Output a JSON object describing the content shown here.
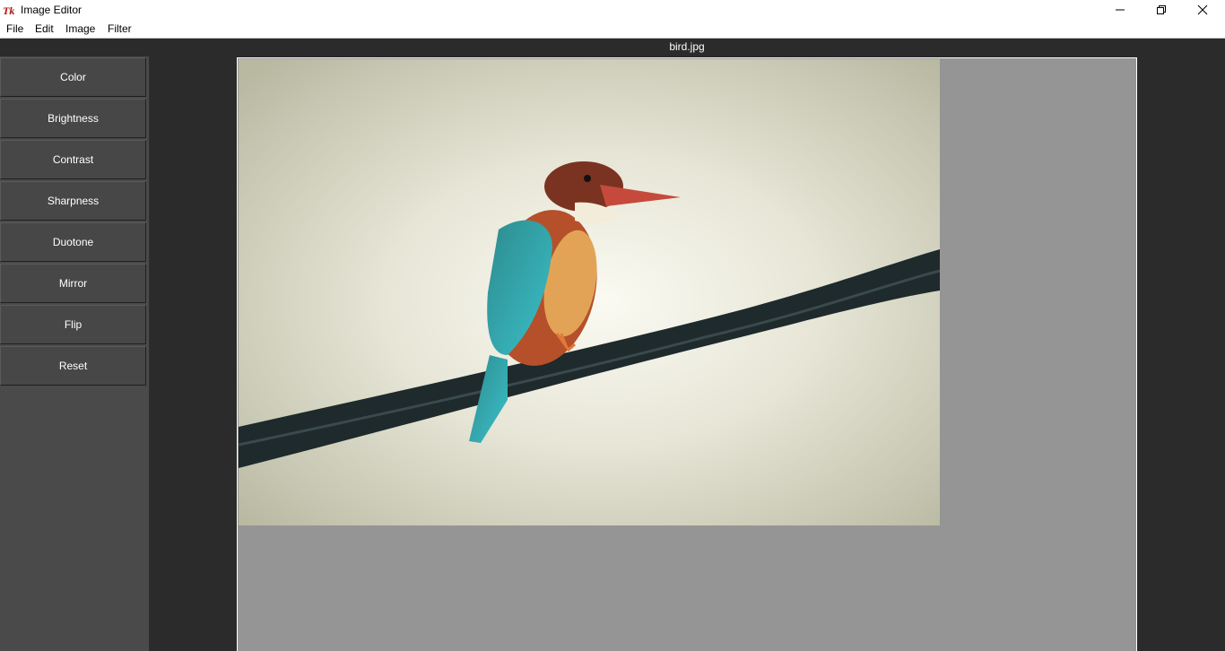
{
  "window": {
    "title": "Image Editor",
    "icon": "tk-feather-icon",
    "controls": [
      "minimize-icon",
      "restore-icon",
      "close-icon"
    ]
  },
  "menu": [
    "File",
    "Edit",
    "Image",
    "Filter"
  ],
  "tools": [
    "Color",
    "Brightness",
    "Contrast",
    "Sharpness",
    "Duotone",
    "Mirror",
    "Flip",
    "Reset"
  ],
  "canvas": {
    "filename": "bird.jpg",
    "image_subject": "kingfisher-on-wire",
    "background_color": "#959595"
  },
  "colors": {
    "window_bg": "#2b2b2b",
    "panel_bg": "#4a4a4a",
    "button_bg": "#474747"
  }
}
